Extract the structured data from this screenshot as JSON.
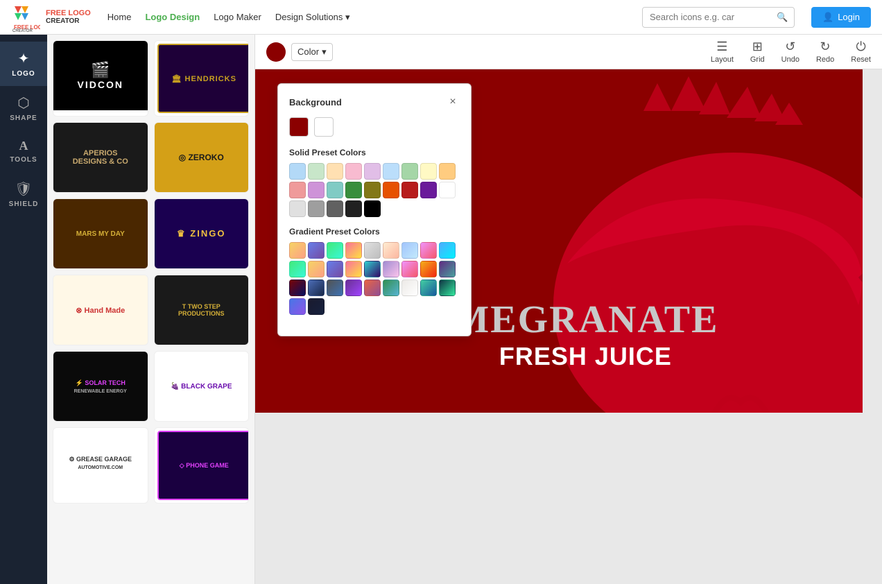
{
  "nav": {
    "brand": "FREE LOGO CREATOR",
    "links": [
      {
        "label": "Home",
        "active": false
      },
      {
        "label": "Logo Design",
        "active": true
      },
      {
        "label": "Logo Maker",
        "active": false
      },
      {
        "label": "Design Solutions",
        "active": false,
        "dropdown": true
      }
    ],
    "search_placeholder": "Search icons e.g. car",
    "login_label": "Login"
  },
  "sidebar": {
    "items": [
      {
        "label": "LOGO",
        "active": true,
        "icon": "✦"
      },
      {
        "label": "SHAPE",
        "active": false,
        "icon": "⬟"
      },
      {
        "label": "TOOLS",
        "active": false,
        "icon": "A"
      },
      {
        "label": "SHIELD",
        "active": false,
        "icon": "🛡"
      }
    ]
  },
  "color_popup": {
    "title": "Background",
    "close_icon": "×",
    "color_label": "Color",
    "dropdown_icon": "▾",
    "solid_section": "Solid Preset Colors",
    "gradient_section": "Gradient Preset Colors",
    "bg_colors": [
      "#8B0000",
      "#ffffff"
    ],
    "solid_colors": [
      "#b3d9f7",
      "#c8e6c9",
      "#ffe0b2",
      "#f8bbd0",
      "#e1bee7",
      "#bbdefb",
      "#a5d6a7",
      "#fff9c4",
      "#ffcc80",
      "#ef9a9a",
      "#ce93d8",
      "#80cbc4",
      "#388e3c",
      "#827717",
      "#e65100",
      "#b71c1c",
      "#6a1b9a",
      "#ffffff",
      "#e0e0e0",
      "#9e9e9e",
      "#616161",
      "#212121",
      "#000000"
    ],
    "gradient_colors": [
      "linear-gradient(135deg,#f6d365,#fda085)",
      "linear-gradient(135deg,#667eea,#764ba2)",
      "linear-gradient(135deg,#43e97b,#38f9d7)",
      "linear-gradient(135deg,#fa709a,#fee140)",
      "linear-gradient(135deg,#e0e0e0,#bdbdbd)",
      "linear-gradient(135deg,#ffecd2,#fcb69f)",
      "linear-gradient(135deg,#a1c4fd,#c2e9fb)",
      "linear-gradient(135deg,#f093fb,#f5576c)",
      "linear-gradient(135deg,#4facfe,#00f2fe)",
      "linear-gradient(135deg,#43e97b,#38f9d7)",
      "linear-gradient(135deg,#f6d365,#fda085)",
      "linear-gradient(135deg,#667eea,#764ba2)",
      "linear-gradient(135deg,#fa709a,#fee140)",
      "linear-gradient(135deg,#30cfd0,#330867)",
      "linear-gradient(135deg,#a18cd1,#fbc2eb)",
      "linear-gradient(135deg,#f093fb,#f5576c)",
      "linear-gradient(135deg,#f5af19,#f12711)",
      "linear-gradient(135deg,#5f2c82,#49a09d)",
      "linear-gradient(135deg,#780206,#061161)",
      "linear-gradient(135deg,#4b6cb7,#182848)",
      "linear-gradient(135deg,#525252,#3d72b4)",
      "linear-gradient(135deg,#6a3093,#a044ff)",
      "linear-gradient(135deg,#e96443,#904e95)",
      "linear-gradient(135deg,#348f50,#56b4d3)",
      "linear-gradient(135deg,#ece9e6,#ffffff)",
      "linear-gradient(135deg,#43cea2,#185a9d)",
      "linear-gradient(135deg,#0f3443,#34e89e)",
      "linear-gradient(135deg,#4776e6,#8e54e9)",
      "linear-gradient(135deg,#1a1a2e,#16213e)"
    ]
  },
  "toolbar": {
    "color_label": "Color",
    "layout_label": "Layout",
    "grid_label": "Grid",
    "undo_label": "Undo",
    "redo_label": "Redo",
    "reset_label": "Reset"
  },
  "canvas": {
    "main_text": "MEGRANATE",
    "sub_text": "FRESH JUICE"
  },
  "logos": [
    {
      "id": "vidcon",
      "name": "VIDCON",
      "bg": "#000000",
      "text_color": "#ffffff"
    },
    {
      "id": "hendricks",
      "name": "HENDRICKS",
      "bg": "#2d0050",
      "text_color": "#d4af37"
    },
    {
      "id": "aperios",
      "name": "APERIOS DESIGNS & CO",
      "bg": "#1a1a1a",
      "text_color": "#c8a96e"
    },
    {
      "id": "zeroko",
      "name": "ZEROKO",
      "bg": "#d4a017",
      "text_color": "#1a1a1a"
    },
    {
      "id": "marsday",
      "name": "MARS MY DAY",
      "bg": "#4a2700",
      "text_color": "#d4af37"
    },
    {
      "id": "zingo",
      "name": "ZINGO",
      "bg": "#1a0050",
      "text_color": "#f0c040"
    },
    {
      "id": "handmade",
      "name": "Hand Made",
      "bg": "#fff8e7",
      "text_color": "#cc3333"
    },
    {
      "id": "twostep",
      "name": "TWO STEP PRODUCTIONS",
      "bg": "#1a1a1a",
      "text_color": "#d4af37"
    },
    {
      "id": "solartech",
      "name": "SOLAR TECH RENEWABLE ENERGY",
      "bg": "#0a0a0a",
      "text_color": "#e040fb"
    },
    {
      "id": "blackgrape",
      "name": "BLACK GRAPE",
      "bg": "#ffffff",
      "text_color": "#6a0dad"
    },
    {
      "id": "greasegarage",
      "name": "GREASE GARAGE AUTOMOTIVE.COM",
      "bg": "#ffffff",
      "text_color": "#333333"
    },
    {
      "id": "phonegame",
      "name": "PHONE GAME",
      "bg": "#1a0040",
      "text_color": "#e040fb"
    }
  ]
}
